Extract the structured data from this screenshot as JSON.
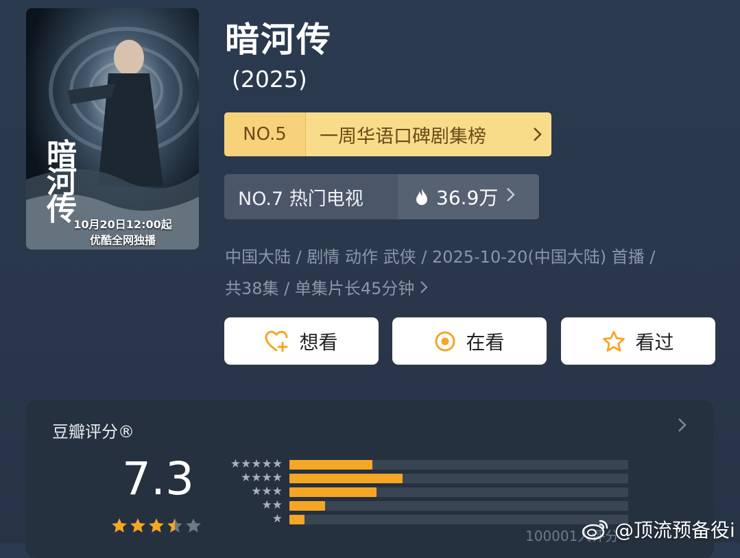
{
  "poster": {
    "calligraphy": "暗河传",
    "caption_line1": "10月20日12:00起",
    "caption_line2": "优酷全网独播"
  },
  "title": "暗河传",
  "year": "(2025)",
  "rank_weekly": {
    "no": "NO.5",
    "name": "一周华语口碑剧集榜"
  },
  "rank_hot": {
    "label": "NO.7 热门电视",
    "heat": "36.9万"
  },
  "info": {
    "line1": "中国大陆 / 剧情 动作 武侠 / 2025-10-20(中国大陆) 首播 /",
    "line2": "共38集 / 单集片长45分钟"
  },
  "actions": {
    "want": "想看",
    "watching": "在看",
    "watched": "看过"
  },
  "rating": {
    "label": "豆瓣评分®",
    "score": "7.3",
    "stars_filled": 3.5,
    "distribution_fractions": [
      0.245,
      0.335,
      0.258,
      0.105,
      0.045
    ],
    "raters": "100001人评分"
  },
  "watermark": "@顶流预备役i",
  "colors": {
    "accent": "#f5a623",
    "badge_gold": "#f8dc8a",
    "background": "#2b3a4f"
  },
  "icons": [
    "heart-plus-icon",
    "target-icon",
    "star-outline-icon",
    "fire-icon",
    "chevron-right-icon",
    "weibo-logo-icon"
  ]
}
